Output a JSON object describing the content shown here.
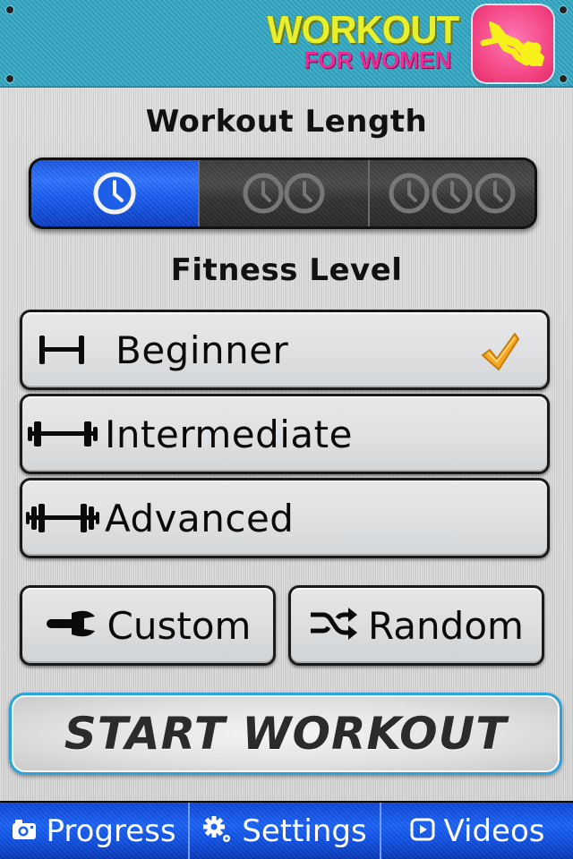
{
  "header": {
    "logo_main": "WORKOUT",
    "logo_sub": "FOR WOMEN",
    "logo_icon": "woman-doing-crunches-icon"
  },
  "workout_length": {
    "title": "Workout Length",
    "options": [
      {
        "icon": "clock-icon",
        "clock_count": 1,
        "selected": true
      },
      {
        "icon": "clock-icon",
        "clock_count": 2,
        "selected": false
      },
      {
        "icon": "clock-icon",
        "clock_count": 3,
        "selected": false
      }
    ]
  },
  "fitness_level": {
    "title": "Fitness Level",
    "options": [
      {
        "label": "Beginner",
        "icon": "dumbbell-light-icon",
        "selected": true
      },
      {
        "label": "Intermediate",
        "icon": "dumbbell-medium-icon",
        "selected": false
      },
      {
        "label": "Advanced",
        "icon": "dumbbell-heavy-icon",
        "selected": false
      }
    ]
  },
  "actions": {
    "custom_label": "Custom",
    "random_label": "Random",
    "start_label": "START WORKOUT"
  },
  "tabbar": {
    "items": [
      {
        "label": "Progress",
        "icon": "camera-icon"
      },
      {
        "label": "Settings",
        "icon": "gear-icon"
      },
      {
        "label": "Videos",
        "icon": "play-icon"
      }
    ]
  },
  "colors": {
    "header_bg": "#33a7c4",
    "logo_yellow": "#e6f02c",
    "logo_pink": "#ee2a94",
    "selected_blue": "#2f74ff",
    "tab_blue": "#1a62f5",
    "start_border": "#2aa4dd",
    "check_orange": "#f5a623"
  }
}
